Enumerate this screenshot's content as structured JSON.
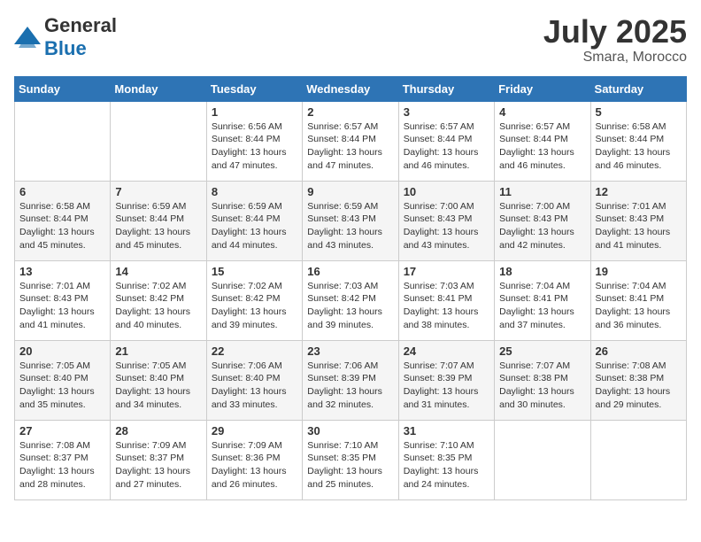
{
  "logo": {
    "general": "General",
    "blue": "Blue"
  },
  "title": {
    "month_year": "July 2025",
    "location": "Smara, Morocco"
  },
  "weekdays": [
    "Sunday",
    "Monday",
    "Tuesday",
    "Wednesday",
    "Thursday",
    "Friday",
    "Saturday"
  ],
  "weeks": [
    [
      {
        "day": "",
        "sunrise": "",
        "sunset": "",
        "daylight": ""
      },
      {
        "day": "",
        "sunrise": "",
        "sunset": "",
        "daylight": ""
      },
      {
        "day": "1",
        "sunrise": "Sunrise: 6:56 AM",
        "sunset": "Sunset: 8:44 PM",
        "daylight": "Daylight: 13 hours and 47 minutes."
      },
      {
        "day": "2",
        "sunrise": "Sunrise: 6:57 AM",
        "sunset": "Sunset: 8:44 PM",
        "daylight": "Daylight: 13 hours and 47 minutes."
      },
      {
        "day": "3",
        "sunrise": "Sunrise: 6:57 AM",
        "sunset": "Sunset: 8:44 PM",
        "daylight": "Daylight: 13 hours and 46 minutes."
      },
      {
        "day": "4",
        "sunrise": "Sunrise: 6:57 AM",
        "sunset": "Sunset: 8:44 PM",
        "daylight": "Daylight: 13 hours and 46 minutes."
      },
      {
        "day": "5",
        "sunrise": "Sunrise: 6:58 AM",
        "sunset": "Sunset: 8:44 PM",
        "daylight": "Daylight: 13 hours and 46 minutes."
      }
    ],
    [
      {
        "day": "6",
        "sunrise": "Sunrise: 6:58 AM",
        "sunset": "Sunset: 8:44 PM",
        "daylight": "Daylight: 13 hours and 45 minutes."
      },
      {
        "day": "7",
        "sunrise": "Sunrise: 6:59 AM",
        "sunset": "Sunset: 8:44 PM",
        "daylight": "Daylight: 13 hours and 45 minutes."
      },
      {
        "day": "8",
        "sunrise": "Sunrise: 6:59 AM",
        "sunset": "Sunset: 8:44 PM",
        "daylight": "Daylight: 13 hours and 44 minutes."
      },
      {
        "day": "9",
        "sunrise": "Sunrise: 6:59 AM",
        "sunset": "Sunset: 8:43 PM",
        "daylight": "Daylight: 13 hours and 43 minutes."
      },
      {
        "day": "10",
        "sunrise": "Sunrise: 7:00 AM",
        "sunset": "Sunset: 8:43 PM",
        "daylight": "Daylight: 13 hours and 43 minutes."
      },
      {
        "day": "11",
        "sunrise": "Sunrise: 7:00 AM",
        "sunset": "Sunset: 8:43 PM",
        "daylight": "Daylight: 13 hours and 42 minutes."
      },
      {
        "day": "12",
        "sunrise": "Sunrise: 7:01 AM",
        "sunset": "Sunset: 8:43 PM",
        "daylight": "Daylight: 13 hours and 41 minutes."
      }
    ],
    [
      {
        "day": "13",
        "sunrise": "Sunrise: 7:01 AM",
        "sunset": "Sunset: 8:43 PM",
        "daylight": "Daylight: 13 hours and 41 minutes."
      },
      {
        "day": "14",
        "sunrise": "Sunrise: 7:02 AM",
        "sunset": "Sunset: 8:42 PM",
        "daylight": "Daylight: 13 hours and 40 minutes."
      },
      {
        "day": "15",
        "sunrise": "Sunrise: 7:02 AM",
        "sunset": "Sunset: 8:42 PM",
        "daylight": "Daylight: 13 hours and 39 minutes."
      },
      {
        "day": "16",
        "sunrise": "Sunrise: 7:03 AM",
        "sunset": "Sunset: 8:42 PM",
        "daylight": "Daylight: 13 hours and 39 minutes."
      },
      {
        "day": "17",
        "sunrise": "Sunrise: 7:03 AM",
        "sunset": "Sunset: 8:41 PM",
        "daylight": "Daylight: 13 hours and 38 minutes."
      },
      {
        "day": "18",
        "sunrise": "Sunrise: 7:04 AM",
        "sunset": "Sunset: 8:41 PM",
        "daylight": "Daylight: 13 hours and 37 minutes."
      },
      {
        "day": "19",
        "sunrise": "Sunrise: 7:04 AM",
        "sunset": "Sunset: 8:41 PM",
        "daylight": "Daylight: 13 hours and 36 minutes."
      }
    ],
    [
      {
        "day": "20",
        "sunrise": "Sunrise: 7:05 AM",
        "sunset": "Sunset: 8:40 PM",
        "daylight": "Daylight: 13 hours and 35 minutes."
      },
      {
        "day": "21",
        "sunrise": "Sunrise: 7:05 AM",
        "sunset": "Sunset: 8:40 PM",
        "daylight": "Daylight: 13 hours and 34 minutes."
      },
      {
        "day": "22",
        "sunrise": "Sunrise: 7:06 AM",
        "sunset": "Sunset: 8:40 PM",
        "daylight": "Daylight: 13 hours and 33 minutes."
      },
      {
        "day": "23",
        "sunrise": "Sunrise: 7:06 AM",
        "sunset": "Sunset: 8:39 PM",
        "daylight": "Daylight: 13 hours and 32 minutes."
      },
      {
        "day": "24",
        "sunrise": "Sunrise: 7:07 AM",
        "sunset": "Sunset: 8:39 PM",
        "daylight": "Daylight: 13 hours and 31 minutes."
      },
      {
        "day": "25",
        "sunrise": "Sunrise: 7:07 AM",
        "sunset": "Sunset: 8:38 PM",
        "daylight": "Daylight: 13 hours and 30 minutes."
      },
      {
        "day": "26",
        "sunrise": "Sunrise: 7:08 AM",
        "sunset": "Sunset: 8:38 PM",
        "daylight": "Daylight: 13 hours and 29 minutes."
      }
    ],
    [
      {
        "day": "27",
        "sunrise": "Sunrise: 7:08 AM",
        "sunset": "Sunset: 8:37 PM",
        "daylight": "Daylight: 13 hours and 28 minutes."
      },
      {
        "day": "28",
        "sunrise": "Sunrise: 7:09 AM",
        "sunset": "Sunset: 8:37 PM",
        "daylight": "Daylight: 13 hours and 27 minutes."
      },
      {
        "day": "29",
        "sunrise": "Sunrise: 7:09 AM",
        "sunset": "Sunset: 8:36 PM",
        "daylight": "Daylight: 13 hours and 26 minutes."
      },
      {
        "day": "30",
        "sunrise": "Sunrise: 7:10 AM",
        "sunset": "Sunset: 8:35 PM",
        "daylight": "Daylight: 13 hours and 25 minutes."
      },
      {
        "day": "31",
        "sunrise": "Sunrise: 7:10 AM",
        "sunset": "Sunset: 8:35 PM",
        "daylight": "Daylight: 13 hours and 24 minutes."
      },
      {
        "day": "",
        "sunrise": "",
        "sunset": "",
        "daylight": ""
      },
      {
        "day": "",
        "sunrise": "",
        "sunset": "",
        "daylight": ""
      }
    ]
  ]
}
